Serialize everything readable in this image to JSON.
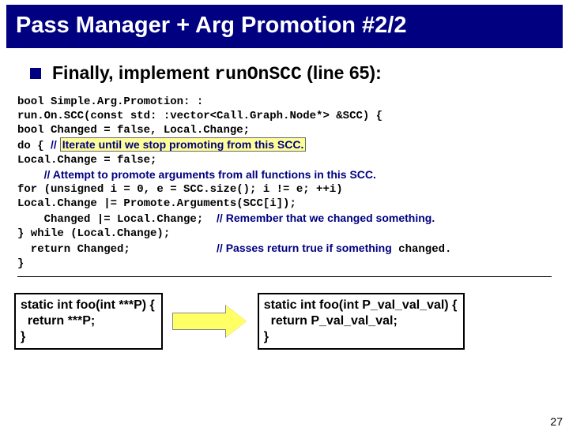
{
  "title": "Pass Manager + Arg Promotion #2/2",
  "bullet": {
    "prefix": "Finally, implement ",
    "code": "runOnSCC",
    "suffix": " (line 65):"
  },
  "code": {
    "l1": "bool Simple.Arg.Promotion: :",
    "l2": "run.On.SCC(const std: :vector<Call.Graph.Node*> &SCC) {",
    "l3": "  bool Changed = false, Local.Change;",
    "l4a": "  do {    ",
    "l4b": "// ",
    "l4c": "Iterate until we stop promoting from this SCC.",
    "l5": "    Local.Change = false;",
    "l6a": "    ",
    "l6b": "// ",
    "l6c": "Attempt to promote arguments from all functions in this SCC.",
    "l7": "    for (unsigned i = 0, e = SCC.size(); i != e; ++i)",
    "l8": "      Local.Change |= Promote.Arguments(SCC[i]);",
    "l9a": "    Changed |= Local.Change;  ",
    "l9b": "// ",
    "l9c": "Remember that we changed something.",
    "l10": "  } while (Local.Change);",
    "l11a": "  return Changed;             ",
    "l11b": "// ",
    "l11c": "Passes return true if something",
    "l11d": " changed.",
    "l12": "}"
  },
  "left_snippet": "static int foo(int ***P) {\n  return ***P;\n}",
  "right_snippet": "static int foo(int P_val_val_val) {\n  return P_val_val_val;\n}",
  "page_number": "27",
  "chart_data": null
}
